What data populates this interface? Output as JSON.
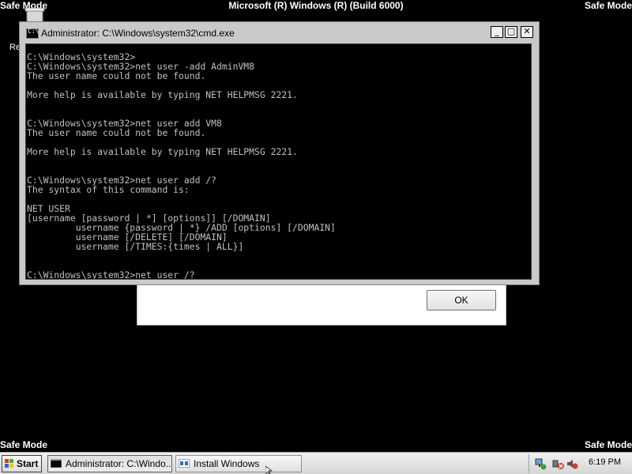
{
  "desktop": {
    "safe_mode": "Safe Mode",
    "build_text": "Microsoft (R) Windows (R) (Build 6000)",
    "icon_label": "Re",
    "icon_name": "recycle-bin-icon"
  },
  "background_dialog": {
    "ok_label": "OK"
  },
  "cmd_window": {
    "title": "Administrator: C:\\Windows\\system32\\cmd.exe",
    "buttons": {
      "minimize": "_",
      "maximize": "□",
      "close": "✕"
    },
    "lines": [
      "C:\\Windows\\system32>",
      "C:\\Windows\\system32>net user -add AdminVM8",
      "The user name could not be found.",
      "",
      "More help is available by typing NET HELPMSG 2221.",
      "",
      "",
      "C:\\Windows\\system32>net user add VM8",
      "The user name could not be found.",
      "",
      "More help is available by typing NET HELPMSG 2221.",
      "",
      "",
      "C:\\Windows\\system32>net user add /?",
      "The syntax of this command is:",
      "",
      "NET USER",
      "[username [password | *] [options]] [/DOMAIN]",
      "         username {password | *} /ADD [options] [/DOMAIN]",
      "         username [/DELETE] [/DOMAIN]",
      "         username [/TIMES:{times | ALL}]",
      "",
      "",
      "C:\\Windows\\system32>net user /?"
    ]
  },
  "taskbar": {
    "start_label": "Start",
    "tasks": [
      {
        "label": "Administrator: C:\\Windo...",
        "icon": "cmd-icon"
      },
      {
        "label": "Install Windows",
        "icon": "setup-icon"
      }
    ],
    "tray": {
      "icons": [
        "network-icon",
        "volume-muted-icon"
      ],
      "clock": "6:19 PM"
    }
  },
  "colors": {
    "console_bg": "#000000",
    "console_fg": "#c0c0c0",
    "window_chrome": "#c9c9c9"
  }
}
